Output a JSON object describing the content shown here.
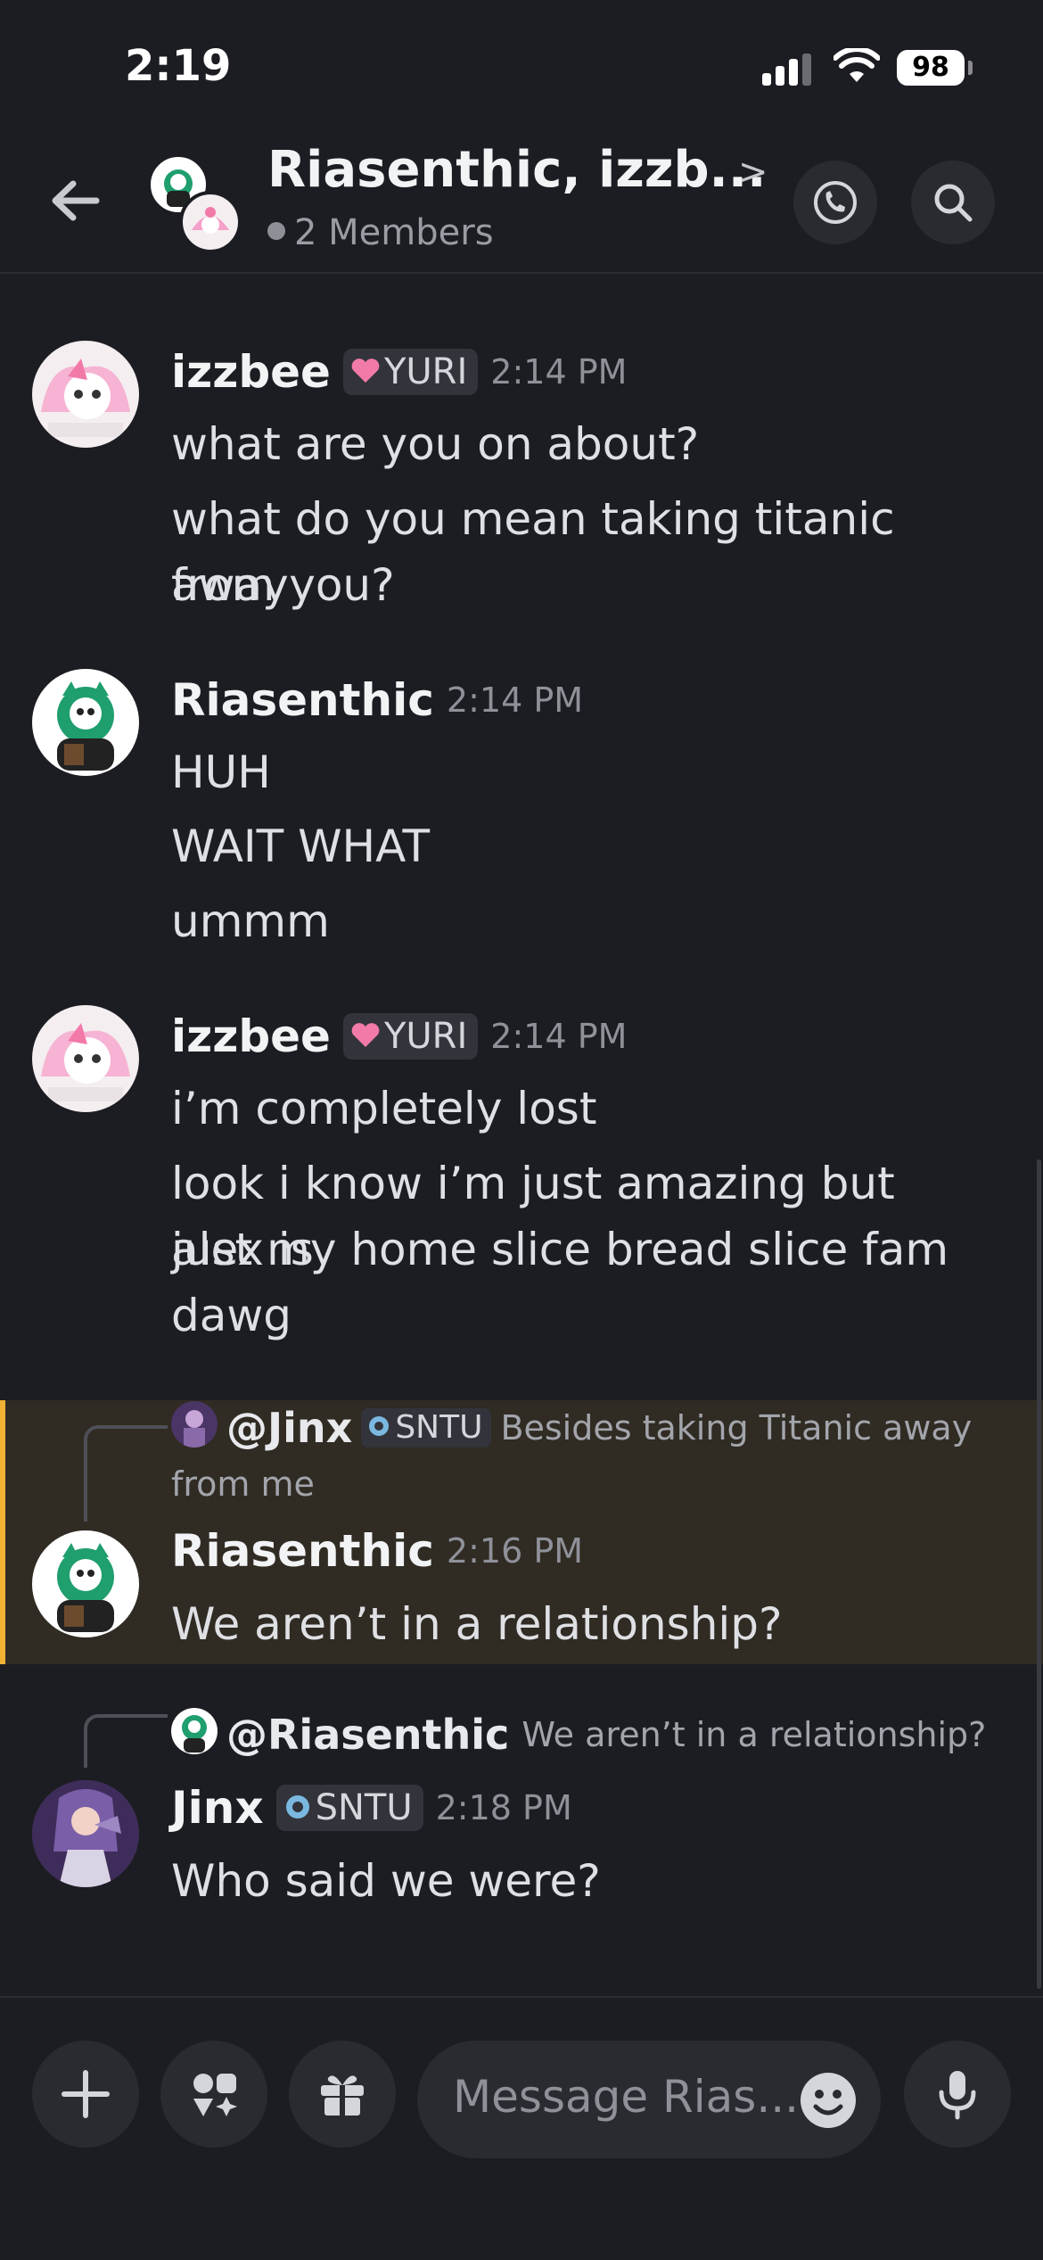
{
  "status_bar": {
    "time": "2:19",
    "battery": "98"
  },
  "header": {
    "title": "Riasenthic, izzb...",
    "chevron": ">",
    "members": "2 Members"
  },
  "messages": [
    {
      "author": "izzbee",
      "tag": "YURI",
      "timestamp": "2:14 PM",
      "lines": [
        "what are you on about?",
        "what do you mean taking titanic away",
        "from you?"
      ]
    },
    {
      "author": "Riasenthic",
      "timestamp": "2:14 PM",
      "lines": [
        "HUH",
        "WAIT WHAT",
        "ummm"
      ]
    },
    {
      "author": "izzbee",
      "tag": "YURI",
      "timestamp": "2:14 PM",
      "lines": [
        "i’m completely lost",
        "look i know i’m just amazing but alex is",
        "just my home slice bread slice fam",
        "dawg"
      ]
    },
    {
      "reply_to": {
        "name": "@Jinx",
        "tag": "SNTU",
        "text": "Besides taking Titanic away",
        "text_cont": "from me"
      },
      "author": "Riasenthic",
      "timestamp": "2:16 PM",
      "lines": [
        "We aren’t in a relationship?"
      ],
      "highlighted": true
    },
    {
      "reply_to": {
        "name": "@Riasenthic",
        "text": "We aren’t in a relationship?"
      },
      "author": "Jinx",
      "tag": "SNTU",
      "timestamp": "2:18 PM",
      "lines": [
        "Who said we were?"
      ]
    }
  ],
  "composer": {
    "placeholder": "Message Rias..."
  },
  "colors": {
    "background": "#1c1d22",
    "highlight_bar": "#f0b232",
    "highlight_bg": "#302b23",
    "yuri_heart": "#f27aa9",
    "sntu_icon": "#7ab8e0"
  },
  "icons": [
    "back-arrow-icon",
    "call-icon",
    "search-icon",
    "plus-icon",
    "apps-icon",
    "gift-icon",
    "emoji-icon",
    "mic-icon",
    "heart-icon",
    "swirl-icon"
  ]
}
